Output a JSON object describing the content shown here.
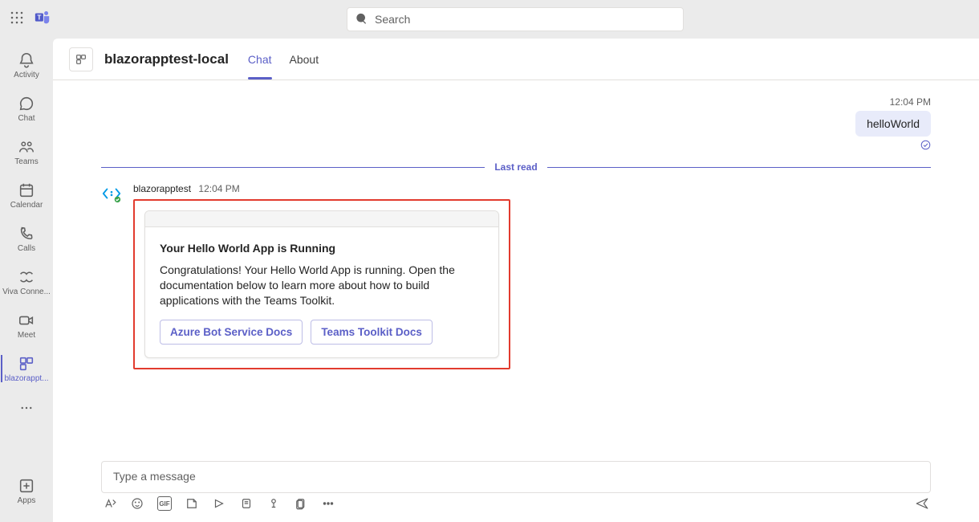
{
  "search": {
    "placeholder": "Search"
  },
  "rail": {
    "items": [
      {
        "label": "Activity"
      },
      {
        "label": "Chat"
      },
      {
        "label": "Teams"
      },
      {
        "label": "Calendar"
      },
      {
        "label": "Calls"
      },
      {
        "label": "Viva Conne..."
      },
      {
        "label": "Meet"
      },
      {
        "label": "blazorappt..."
      }
    ],
    "apps_label": "Apps"
  },
  "header": {
    "app_title": "blazorapptest-local",
    "tabs": [
      {
        "label": "Chat"
      },
      {
        "label": "About"
      }
    ]
  },
  "chat": {
    "outgoing": {
      "time": "12:04 PM",
      "text": "helloWorld"
    },
    "divider": "Last read",
    "bot": {
      "name": "blazorapptest",
      "time": "12:04 PM",
      "card": {
        "title": "Your Hello World App is Running",
        "text": "Congratulations! Your Hello World App is running. Open the documentation below to learn more about how to build applications with the Teams Toolkit.",
        "buttons": [
          "Azure Bot Service Docs",
          "Teams Toolkit Docs"
        ]
      }
    }
  },
  "compose": {
    "placeholder": "Type a message",
    "gif_label": "GIF"
  }
}
